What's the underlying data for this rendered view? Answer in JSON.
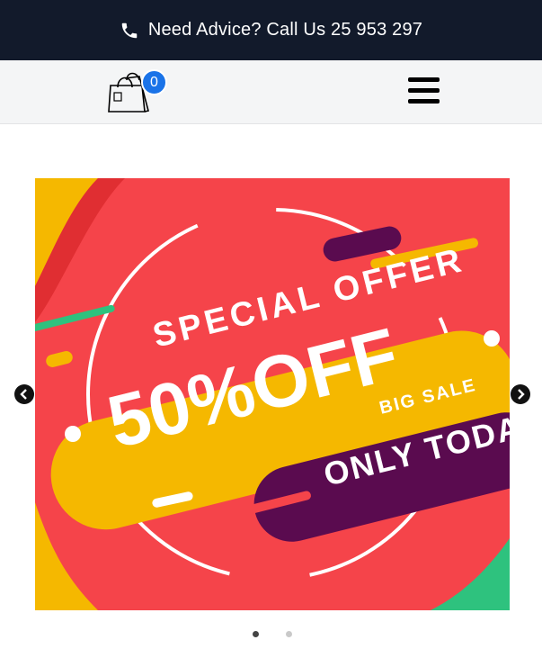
{
  "topbar": {
    "text": "Need Advice? Call Us 25 953 297",
    "icon": "phone-icon",
    "background": "#121a2b"
  },
  "header": {
    "cart_count": "0",
    "cart_icon": "shopping-bag-icon",
    "menu_icon": "hamburger-icon"
  },
  "slider": {
    "slide_texts": {
      "headline": "SPECIAL OFFER",
      "discount": "50%OFF",
      "tag": "BIG SALE",
      "footer": "ONLY TODAY"
    },
    "colors": {
      "red": "#f5444a",
      "yellow": "#f5b800",
      "purple": "#5a0b4f",
      "green": "#2ec27e"
    },
    "prev_icon": "chevron-left-icon",
    "next_icon": "chevron-right-icon",
    "active_slide": 1,
    "total_slides": 2
  }
}
